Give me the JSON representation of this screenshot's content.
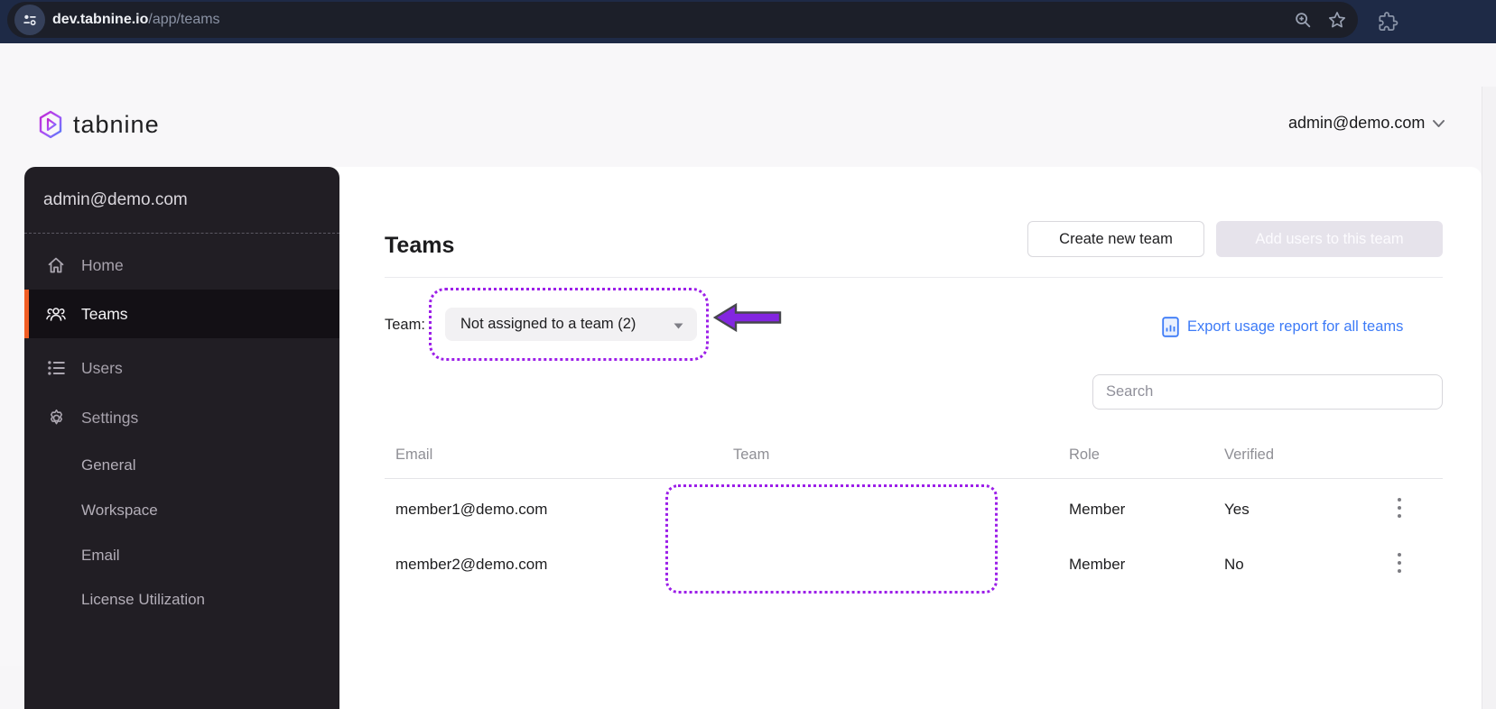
{
  "browser": {
    "url_host": "dev.tabnine.io",
    "url_path": "/app/teams",
    "icons": {
      "site_badge": "sliders-icon",
      "right_1": "zoom-in-icon",
      "right_2": "star-icon",
      "outside": "puzzle-icon"
    }
  },
  "header": {
    "logo_text": "tabnine",
    "account": "admin@demo.com",
    "account_chevron": "chevron-down-icon"
  },
  "sidebar": {
    "account": "admin@demo.com",
    "items": [
      {
        "label": "Home",
        "icon": "home-icon",
        "active": false
      },
      {
        "label": "Teams",
        "icon": "people-icon",
        "active": true
      },
      {
        "label": "Users",
        "icon": "list-icon",
        "active": false
      },
      {
        "label": "Settings",
        "icon": "gear-icon",
        "active": false
      }
    ],
    "sub_items": [
      {
        "label": "General"
      },
      {
        "label": "Workspace"
      },
      {
        "label": "Email"
      },
      {
        "label": "License Utilization"
      }
    ],
    "active_accent_color": "#f05d24"
  },
  "main": {
    "title": "Teams",
    "create_button": "Create new team",
    "add_users_button": "Add users to this team",
    "team_filter_label": "Team:",
    "team_filter_value": "Not assigned to a team (2)",
    "export_link": "Export usage report for all teams",
    "export_icon": "document-chart-icon",
    "search_placeholder": "Search",
    "table": {
      "columns": {
        "email": "Email",
        "team": "Team",
        "role": "Role",
        "verified": "Verified"
      },
      "rows": [
        {
          "email": "member1@demo.com",
          "team": "",
          "role": "Member",
          "verified": "Yes"
        },
        {
          "email": "member2@demo.com",
          "team": "",
          "role": "Member",
          "verified": "No"
        }
      ]
    },
    "annotations": {
      "color": "#9c1fe8",
      "dropdown_box": "dotted highlight around team dropdown",
      "arrow": "arrow pointing left at team dropdown",
      "team_column_box": "dotted highlight around empty Team cells"
    }
  },
  "colors": {
    "topbar_bg": "#1e2a46",
    "sidebar_bg": "#211e24",
    "accent_orange": "#f05d24",
    "link_blue": "#3d7bf7",
    "annotation_purple": "#9c1fe8",
    "disabled_button_bg": "#e6e3eb"
  }
}
